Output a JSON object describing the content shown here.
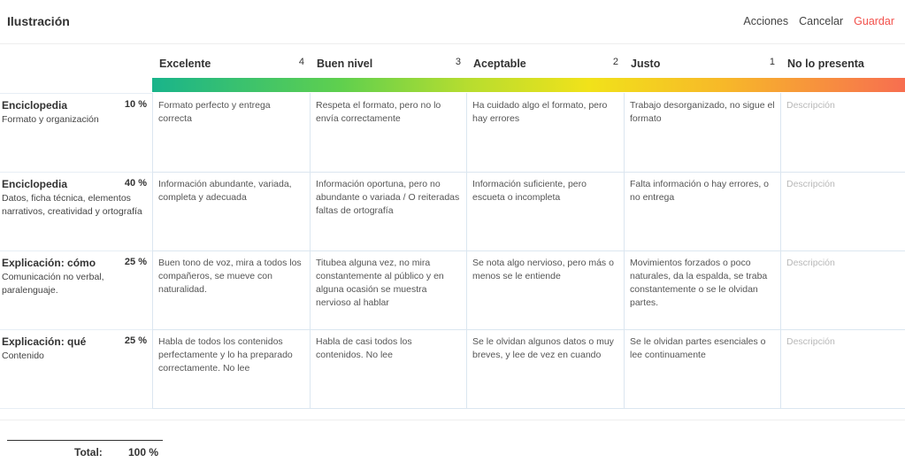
{
  "app": {
    "title": "Ilustración"
  },
  "actions": {
    "acciones": "Acciones",
    "cancelar": "Cancelar",
    "guardar": "Guardar"
  },
  "colors": {
    "accent_save": "#f2504b",
    "gradient": [
      "#19b48b",
      "#5fd04e",
      "#b7dd2f",
      "#f1e21a",
      "#f7b829",
      "#f76e50"
    ]
  },
  "levels": [
    {
      "name": "Excelente",
      "score": "4"
    },
    {
      "name": "Buen nivel",
      "score": "3"
    },
    {
      "name": "Aceptable",
      "score": "2"
    },
    {
      "name": "Justo",
      "score": "1"
    },
    {
      "name": "No lo presenta",
      "score": ""
    }
  ],
  "criteria": [
    {
      "title": "Enciclopedia",
      "weight": "10 %",
      "subtitle": "Formato y organización",
      "cells": [
        "Formato perfecto y entrega correcta",
        "Respeta el formato, pero no lo envía correctamente",
        "Ha cuidado algo el formato, pero hay errores",
        "Trabajo desorganizado, no sigue el formato",
        "Descripción"
      ]
    },
    {
      "title": "Enciclopedia",
      "weight": "40 %",
      "subtitle": "Datos, ficha técnica, elementos narrativos, creatividad y ortografía",
      "cells": [
        "Información abundante, variada, completa y adecuada",
        "Información oportuna, pero no abundante o variada / O reiteradas faltas de ortografía",
        "Información suficiente, pero escueta o incompleta",
        "Falta información o hay errores, o no entrega",
        "Descripción"
      ]
    },
    {
      "title": "Explicación: cómo",
      "weight": "25 %",
      "subtitle": "Comunicación no verbal, paralenguaje.",
      "cells": [
        "Buen tono de voz, mira a todos los compañeros, se mueve con naturalidad.",
        "Titubea alguna vez, no mira constantemente al público y en alguna ocasión se muestra nervioso al hablar",
        "Se nota algo nervioso, pero más o menos se le entiende",
        "Movimientos forzados o poco naturales, da la espalda, se traba constantemente o se le olvidan partes.",
        "Descripción"
      ]
    },
    {
      "title": "Explicación: qué",
      "weight": "25 %",
      "subtitle": "Contenido",
      "cells": [
        "Habla de todos los contenidos perfectamente y lo ha preparado correctamente. No lee",
        "Habla de casi todos los contenidos. No lee",
        "Se le olvidan algunos datos o muy breves, y lee de vez en cuando",
        "Se le olvidan partes esenciales o lee continuamente",
        "Descripción"
      ]
    }
  ],
  "total": {
    "label": "Total:",
    "value": "100 %"
  }
}
